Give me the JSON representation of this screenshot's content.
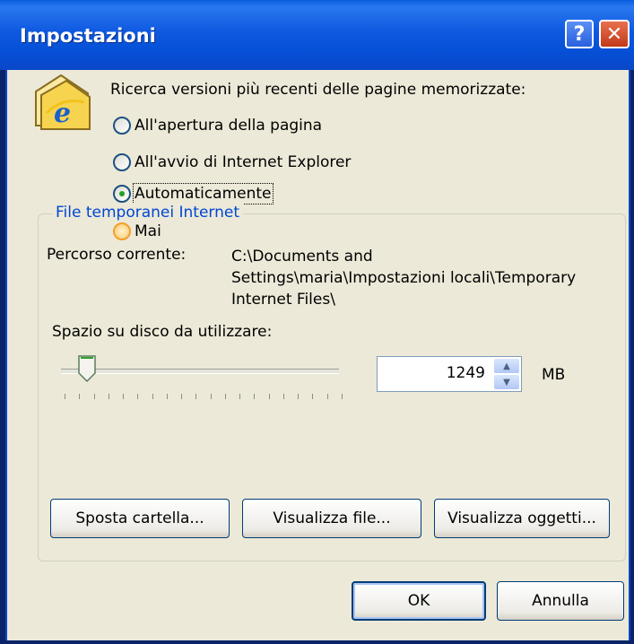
{
  "window": {
    "title": "Impostazioni",
    "help_label": "?",
    "close_label": "✕"
  },
  "check": {
    "prompt": "Ricerca versioni più recenti delle pagine memorizzate:",
    "options": [
      {
        "label": "All'apertura della pagina",
        "checked": false
      },
      {
        "label": "All'avvio di Internet Explorer",
        "checked": false
      },
      {
        "label": "Automaticamente",
        "checked": true
      },
      {
        "label": "Mai",
        "checked": false
      }
    ]
  },
  "temp_files": {
    "group_title": "File temporanei Internet",
    "path_label": "Percorso corrente:",
    "path_lines": [
      "C:\\Documents and",
      "Settings\\maria\\Impostazioni locali\\Temporary",
      "Internet Files\\"
    ],
    "disk_label": "Spazio su disco da utilizzare:",
    "disk_value": "1249",
    "disk_unit": "MB",
    "slider_fraction": 0.06
  },
  "buttons": {
    "move_folder": "Sposta cartella...",
    "view_files": "Visualizza file...",
    "view_objects": "Visualizza oggetti...",
    "ok": "OK",
    "cancel": "Annulla"
  },
  "icons": {
    "settings_icon": "ie-folder-icon",
    "help": "help-icon",
    "close": "close-icon",
    "spin_up": "chevron-up-icon",
    "spin_down": "chevron-down-icon"
  }
}
